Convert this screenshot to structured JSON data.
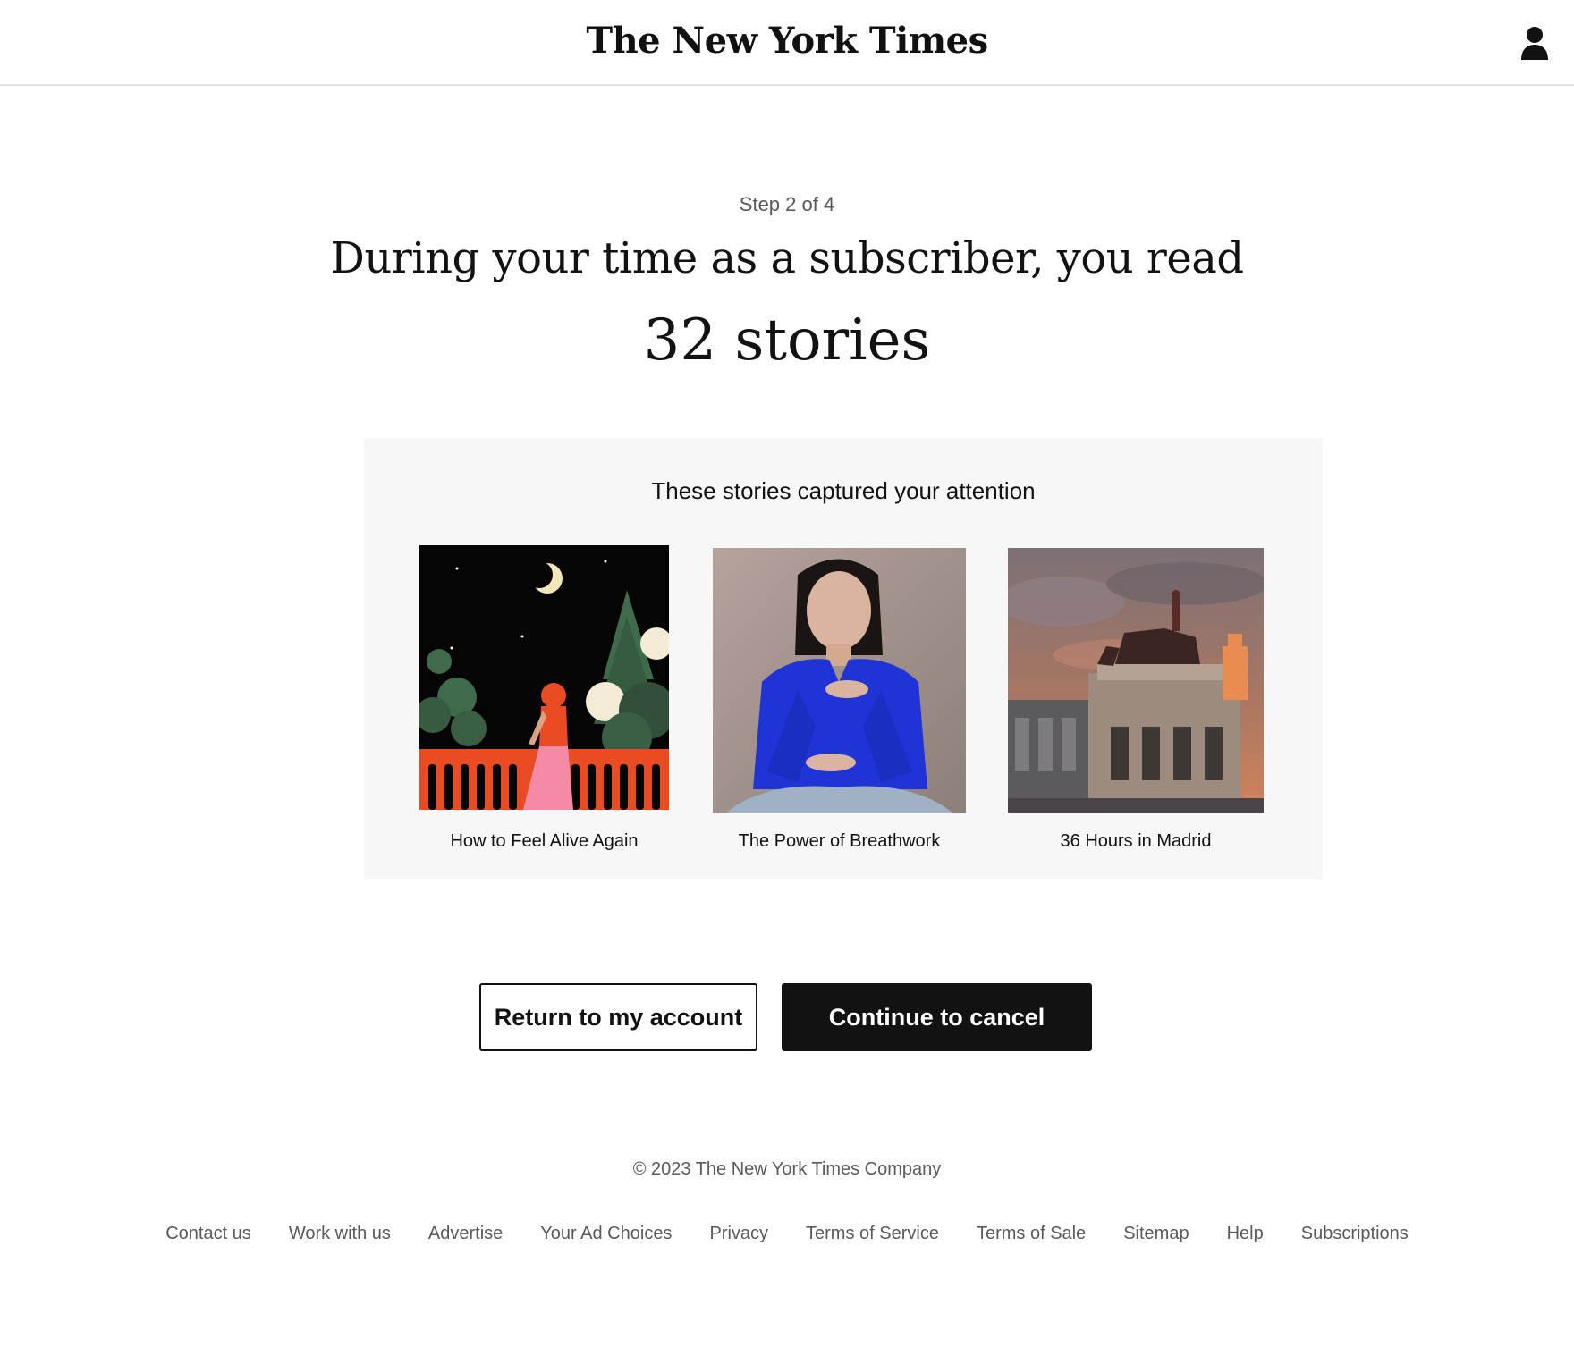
{
  "header": {
    "logo_text": "The New York Times",
    "account_icon": "person-icon"
  },
  "main": {
    "step_label": "Step 2 of 4",
    "headline": "During your time as a subscriber, you read",
    "story_count": "32 stories"
  },
  "stories_panel": {
    "title": "These stories captured your attention",
    "stories": [
      {
        "caption": "How to Feel Alive Again"
      },
      {
        "caption": "The Power of Breathwork"
      },
      {
        "caption": "36 Hours in Madrid"
      }
    ]
  },
  "actions": {
    "return_label": "Return to my account",
    "cancel_label": "Continue to cancel"
  },
  "footer": {
    "copyright": "© 2023 The New York Times Company",
    "links": [
      "Contact us",
      "Work with us",
      "Advertise",
      "Your Ad Choices",
      "Privacy",
      "Terms of Service",
      "Terms of Sale",
      "Sitemap",
      "Help",
      "Subscriptions"
    ]
  },
  "colors": {
    "text": "#121212",
    "muted": "#5a5a5a",
    "panel_bg": "#f7f7f7",
    "divider": "#e2e2e2",
    "primary_button": "#121212"
  }
}
